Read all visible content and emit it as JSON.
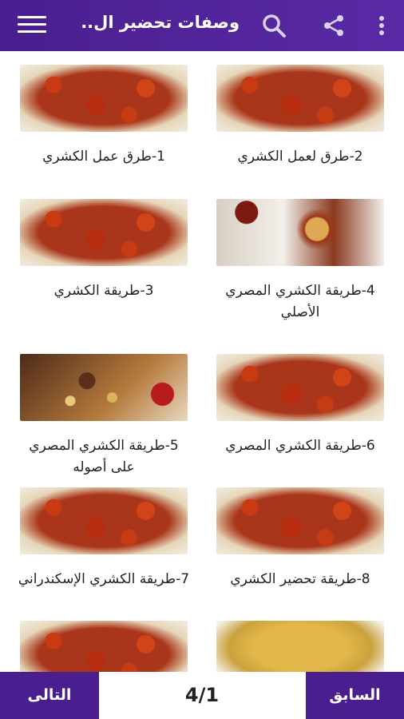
{
  "header": {
    "title": "وصفات تحضير ال..",
    "menu_icon": "hamburger-menu-icon",
    "search_icon": "search-icon",
    "share_icon": "share-icon",
    "more_icon": "more-vert-icon",
    "color": "#4a1e8e"
  },
  "recipes": [
    {
      "label": "1-طرق عمل الكشري",
      "image": "koshari-plate"
    },
    {
      "label": "2-طرق لعمل الكشري",
      "image": "koshari-plate"
    },
    {
      "label": "3-طريقة الكشري",
      "image": "koshari-plate"
    },
    {
      "label": "4-طريقة الكشري المصري الأصلي",
      "image": "koshari-plate"
    },
    {
      "label": "5-طريقة الكشري المصري على أصوله",
      "image": "koshari-bowl"
    },
    {
      "label": "6-طريقة الكشري المصري",
      "image": "koshari-plate"
    },
    {
      "label": "7-طريقة الكشري الإسكندراني",
      "image": "koshari-plate"
    },
    {
      "label": "8-طريقة تحضير الكشري",
      "image": "koshari-plate"
    },
    {
      "label": "",
      "image": "koshari-plate"
    },
    {
      "label": "",
      "image": "soup-bowl"
    }
  ],
  "pagination": {
    "next_label": "التالى",
    "prev_label": "السابق",
    "page_indicator": "4/1"
  }
}
